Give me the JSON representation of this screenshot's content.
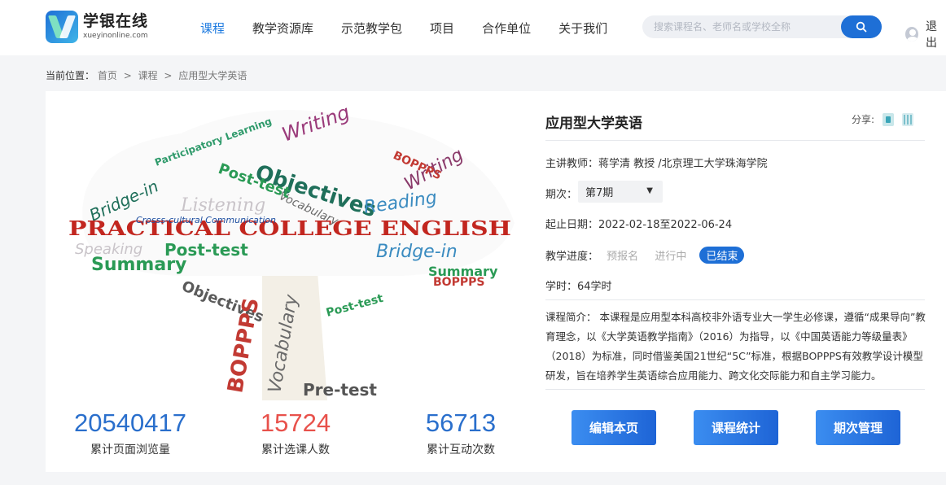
{
  "brand": {
    "name_cn": "学银在线",
    "domain": "xueyinonline.com"
  },
  "nav": {
    "items": [
      {
        "label": "课程",
        "active": true
      },
      {
        "label": "教学资源库"
      },
      {
        "label": "示范教学包"
      },
      {
        "label": "项目"
      },
      {
        "label": "合作单位"
      },
      {
        "label": "关于我们"
      }
    ]
  },
  "search": {
    "placeholder": "搜索课程名、老师名或学校全称",
    "icon": "search-icon"
  },
  "user": {
    "logout_label": "退出"
  },
  "breadcrumb": {
    "prefix": "当前位置：",
    "home": "首页",
    "courses": "课程",
    "current": "应用型大学英语",
    "separator": ">"
  },
  "cover": {
    "words": {
      "main": "PRACTICAL COLLEGE ENGLISH",
      "objectives": "Objectives",
      "post_test": "Post-test",
      "summary": "Summary",
      "bridge_in": "Bridge-in",
      "reading": "Reading",
      "writing": "Writing",
      "vocabulary": "Vocabulary",
      "bopps": "BOPPPS",
      "pre_test": "Pre-test",
      "speaking": "Speaking",
      "listening": "Listening",
      "participatory": "Participatory Learning",
      "cross_cultural": "Crosss-cultural Communication"
    }
  },
  "stats": [
    {
      "value": "20540417",
      "label": "累计页面浏览量",
      "color": "#2a6fcc"
    },
    {
      "value": "15724",
      "label": "累计选课人数",
      "color": "#e8514b"
    },
    {
      "value": "56713",
      "label": "累计互动次数",
      "color": "#2a6fcc"
    }
  ],
  "course": {
    "title": "应用型大学英语",
    "share_label": "分享:",
    "teacher": "主讲教师：蒋学清 教授 /北京理工大学珠海学院",
    "period_label": "期次：",
    "period_value": "第7期",
    "dates": "起止日期：2022-02-18至2022-06-24",
    "progress_label": "教学进度：",
    "progress_steps": [
      "预报名",
      "进行中",
      "已结束"
    ],
    "hours": "学时：64学时",
    "intro": "课程简介：  本课程是应用型本科高校非外语专业大一学生必修课，遵循“成果导向”教育理念，以《大学英语教学指南》（2016）为指导，以《中国英语能力等级量表》（2018）为标准，同时借鉴美国21世纪“5C”标准，根据BOPPPS有效教学设计模型研发，旨在培养学生英语综合应用能力、跨文化交际能力和自主学习能力。"
  },
  "actions": {
    "edit": "编辑本页",
    "stats": "课程统计",
    "periods": "期次管理"
  }
}
